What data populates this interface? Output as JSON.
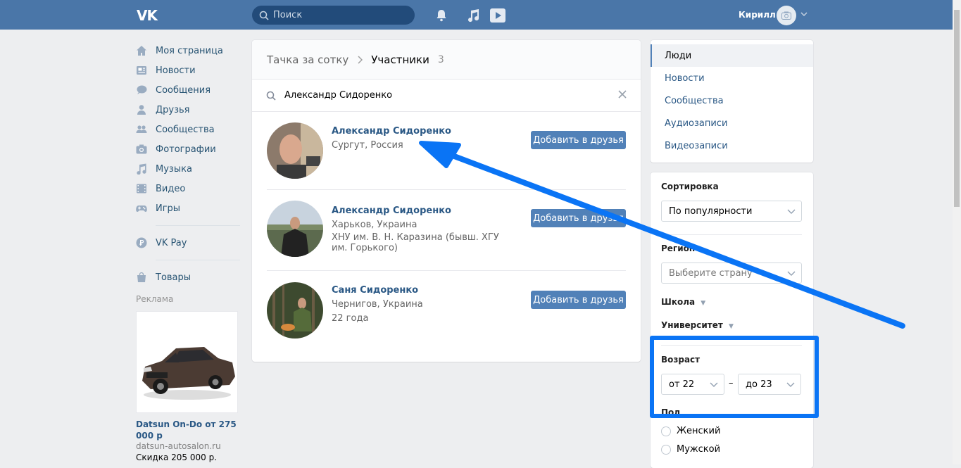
{
  "header": {
    "logo": "VK",
    "search_placeholder": "Поиск",
    "user_name": "Кирилл"
  },
  "sidebar": {
    "items": [
      {
        "label": "Моя страница",
        "icon": "home-icon"
      },
      {
        "label": "Новости",
        "icon": "news-icon"
      },
      {
        "label": "Сообщения",
        "icon": "messages-icon"
      },
      {
        "label": "Друзья",
        "icon": "friends-icon"
      },
      {
        "label": "Сообщества",
        "icon": "communities-icon"
      },
      {
        "label": "Фотографии",
        "icon": "camera-icon"
      },
      {
        "label": "Музыка",
        "icon": "music-icon"
      },
      {
        "label": "Видео",
        "icon": "video-icon"
      },
      {
        "label": "Игры",
        "icon": "gamepad-icon"
      }
    ],
    "vkpay": "VK Pay",
    "goods": "Товары",
    "ad_label": "Реклама",
    "ad_title": "Datsun On-Do от 275 000 р",
    "ad_site": "datsun-autosalon.ru",
    "ad_desc": "Скидка 205 000 р."
  },
  "main": {
    "crumb_group": "Тачка за сотку",
    "crumb_page": "Участники",
    "crumb_count": "3",
    "search_value": "Александр Сидоренко",
    "people": [
      {
        "name": "Александр Сидоренко",
        "line1": "Сургут, Россия",
        "line2": "",
        "button": "Добавить в друзья"
      },
      {
        "name": "Александр Сидоренко",
        "line1": "Харьков, Украина",
        "line2": "ХНУ им. В. Н. Каразина (бывш. ХГУ им. Горького)",
        "button": "Добавить в друзья"
      },
      {
        "name": "Саня Сидоренко",
        "line1": "Чернигов, Украина",
        "line2": "22 года",
        "button": "Добавить в друзья"
      }
    ]
  },
  "right": {
    "tabs": [
      "Люди",
      "Новости",
      "Сообщества",
      "Аудиозаписи",
      "Видеозаписи"
    ],
    "sort_label": "Сортировка",
    "sort_value": "По популярности",
    "region_label": "Регион",
    "region_placeholder": "Выберите страну",
    "school_label": "Школа",
    "university_label": "Университет",
    "age_label": "Возраст",
    "age_from": "от 22",
    "age_dash": "–",
    "age_to": "до 23",
    "gender_label": "Пол",
    "gender_female": "Женский",
    "gender_male": "Мужской"
  },
  "colors": {
    "header": "#4a76a8",
    "link": "#2a5885",
    "button": "#5181b8",
    "annotation": "#0a74f5"
  }
}
